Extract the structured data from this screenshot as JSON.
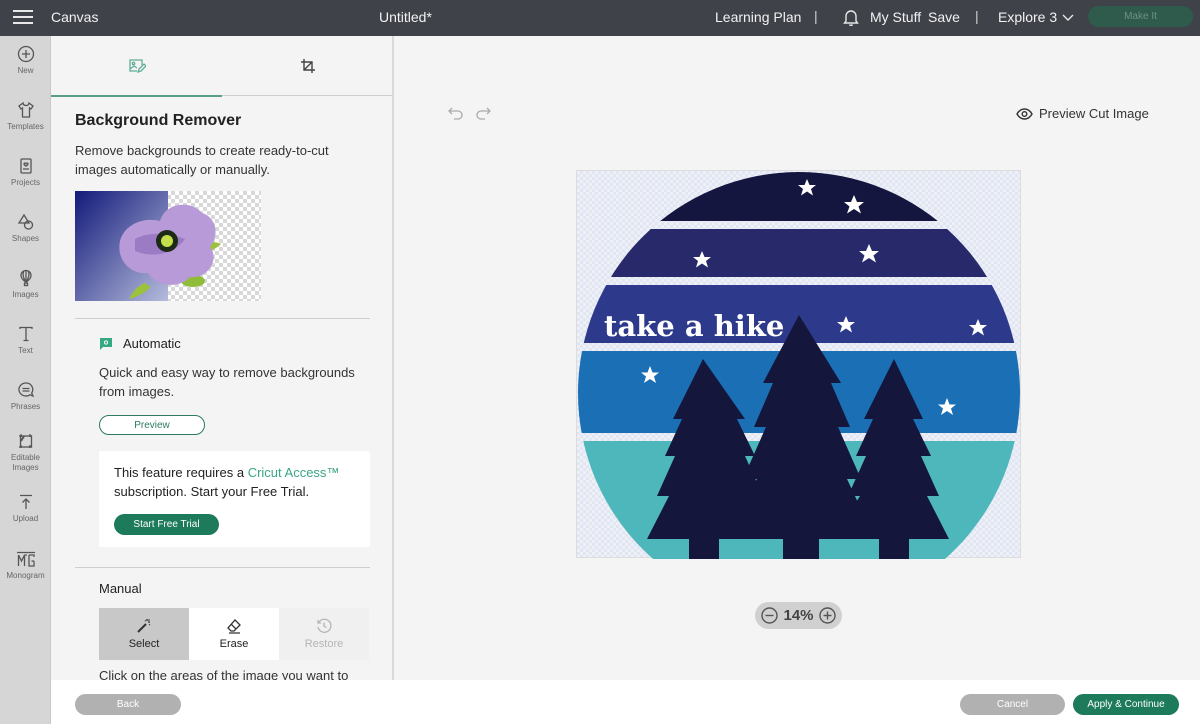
{
  "topbar": {
    "app_title": "Canvas",
    "doc_title": "Untitled*",
    "learning_plan": "Learning Plan",
    "separator": "|",
    "my_stuff": "My Stuff",
    "save": "Save",
    "machine": "Explore 3",
    "make_it": "Make It"
  },
  "rail": {
    "items": [
      {
        "label": "New",
        "icon": "plus-circle-icon"
      },
      {
        "label": "Templates",
        "icon": "shirt-icon"
      },
      {
        "label": "Projects",
        "icon": "projects-icon"
      },
      {
        "label": "Shapes",
        "icon": "shapes-icon"
      },
      {
        "label": "Images",
        "icon": "balloon-icon"
      },
      {
        "label": "Text",
        "icon": "text-icon"
      },
      {
        "label": "Phrases",
        "icon": "speech-bubble-icon"
      },
      {
        "label": "Editable",
        "label2": "Images",
        "icon": "editable-images-icon"
      },
      {
        "label": "Upload",
        "icon": "upload-icon"
      },
      {
        "label": "Monogram",
        "icon": "monogram-icon"
      }
    ]
  },
  "panel": {
    "tabs": [
      {
        "name": "background-remover",
        "icon": "image-edit-icon",
        "active": true
      },
      {
        "name": "crop",
        "icon": "crop-icon",
        "active": false
      }
    ],
    "title": "Background Remover",
    "description": "Remove backgrounds to create ready-to-cut images automatically or manually.",
    "automatic": {
      "heading": "Automatic",
      "description": "Quick and easy way to remove backgrounds from images.",
      "preview_button": "Preview"
    },
    "access_card": {
      "text_before": "This feature requires a ",
      "link_text": "Cricut Access™",
      "text_after": " subscription. Start your Free Trial.",
      "button": "Start Free Trial"
    },
    "manual": {
      "heading": "Manual",
      "tools": [
        {
          "label": "Select",
          "icon": "magic-wand-icon",
          "state": "selected"
        },
        {
          "label": "Erase",
          "icon": "eraser-icon",
          "state": "normal"
        },
        {
          "label": "Restore",
          "icon": "restore-icon",
          "state": "disabled"
        }
      ],
      "hint": "Click on the areas of the image you want to"
    }
  },
  "canvas": {
    "preview_cut": "Preview Cut Image",
    "zoom": "14%",
    "image_text": "take a hike",
    "colors": {
      "band1": "#15163f",
      "band2": "#28296b",
      "band3": "#2d3a8c",
      "band4": "#1a6fb5",
      "band5": "#4db7bb",
      "trees": "#14163b"
    }
  },
  "footer": {
    "back": "Back",
    "cancel": "Cancel",
    "apply": "Apply & Continue"
  },
  "colors": {
    "accent": "#1d7a5b",
    "link": "#3aa486",
    "topbar": "#3f4249"
  }
}
